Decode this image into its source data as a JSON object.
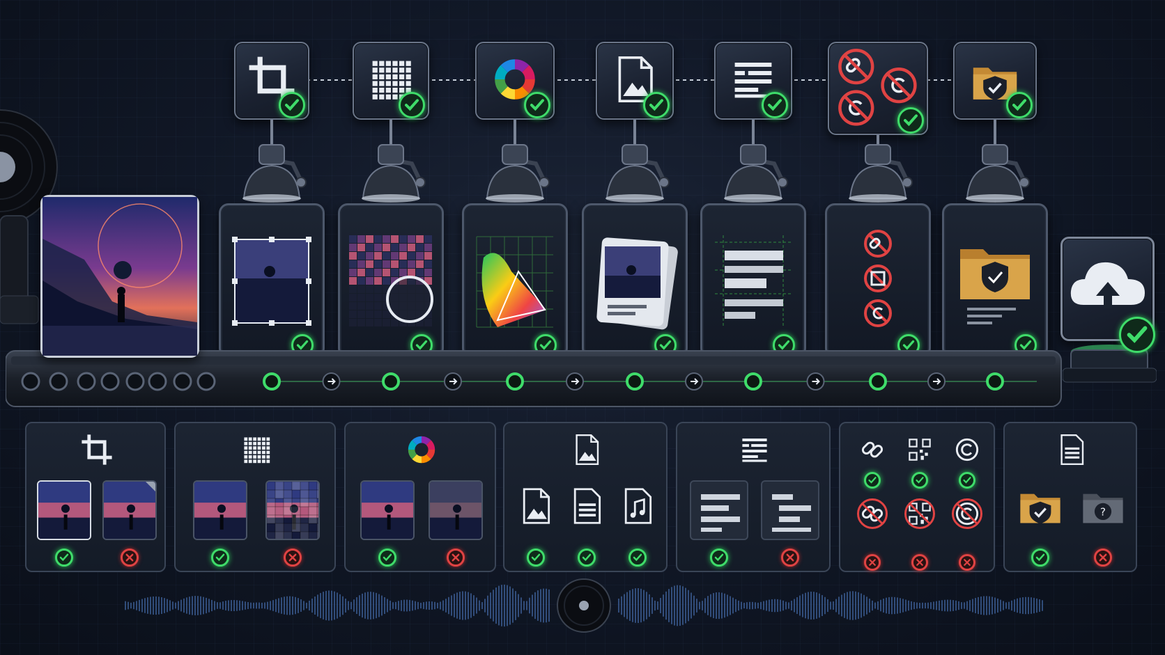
{
  "pipeline": {
    "stages": [
      {
        "id": "crop",
        "icon": "crop-icon",
        "status": "pass"
      },
      {
        "id": "pixel-grid",
        "icon": "grid-icon",
        "status": "pass"
      },
      {
        "id": "color",
        "icon": "color-wheel-icon",
        "status": "pass"
      },
      {
        "id": "file-type",
        "icon": "image-file-icon",
        "status": "pass"
      },
      {
        "id": "text-layout",
        "icon": "text-lines-icon",
        "status": "pass"
      },
      {
        "id": "no-links-qr-copyright",
        "icon": "prohibited-marks-icon",
        "status": "pass"
      },
      {
        "id": "secure-folder",
        "icon": "shield-folder-icon",
        "status": "pass"
      }
    ],
    "upload": {
      "icon": "cloud-upload-icon",
      "status": "pass"
    }
  },
  "examples": [
    {
      "id": "crop",
      "items": [
        {
          "icon": "cropped-artwork",
          "result": "pass"
        },
        {
          "icon": "uncropped-artwork",
          "result": "fail"
        }
      ]
    },
    {
      "id": "resolution",
      "items": [
        {
          "icon": "sharp-artwork",
          "result": "pass"
        },
        {
          "icon": "pixelated-artwork",
          "result": "fail"
        }
      ]
    },
    {
      "id": "color",
      "items": [
        {
          "icon": "full-color-artwork",
          "result": "pass"
        },
        {
          "icon": "dull-artwork",
          "result": "fail"
        }
      ]
    },
    {
      "id": "format",
      "items": [
        {
          "icon": "image-file-icon",
          "result": "pass"
        },
        {
          "icon": "document-file-icon",
          "result": "pass"
        },
        {
          "icon": "music-file-icon",
          "result": "pass"
        }
      ]
    },
    {
      "id": "text",
      "items": [
        {
          "icon": "left-aligned-text",
          "result": "pass"
        },
        {
          "icon": "misaligned-text",
          "result": "fail"
        }
      ]
    },
    {
      "id": "marks",
      "items": [
        {
          "icon": "link-icon",
          "result": "pass"
        },
        {
          "icon": "qr-icon",
          "result": "pass"
        },
        {
          "icon": "copyright-icon",
          "result": "pass"
        },
        {
          "icon": "link-icon",
          "result": "fail"
        },
        {
          "icon": "qr-icon",
          "result": "fail"
        },
        {
          "icon": "copyright-icon",
          "result": "fail"
        }
      ]
    },
    {
      "id": "folder",
      "items": [
        {
          "icon": "shield-folder-icon",
          "result": "pass"
        },
        {
          "icon": "unknown-folder-icon",
          "result": "fail"
        }
      ]
    }
  ],
  "colors": {
    "pass": "#3fdc6a",
    "fail": "#e04343",
    "accent": "#4f7cc4",
    "folder": "#d9a44a"
  }
}
